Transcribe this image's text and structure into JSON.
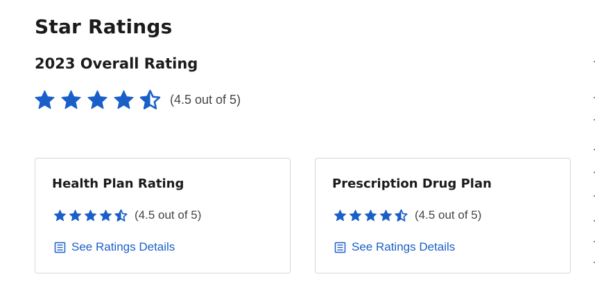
{
  "page": {
    "title": "Star Ratings"
  },
  "overall": {
    "heading": "2023 Overall Rating",
    "rating": 4.5,
    "max": 5,
    "rating_text": "(4.5 out of 5)"
  },
  "cards": [
    {
      "title": "Health Plan Rating",
      "rating": 4.5,
      "max": 5,
      "rating_text": "(4.5 out of 5)",
      "link_label": "See Ratings Details",
      "link_icon": "document-list-icon"
    },
    {
      "title": "Prescription Drug Plan",
      "rating": 4.5,
      "max": 5,
      "rating_text": "(4.5 out of 5)",
      "link_label": "See Ratings Details",
      "link_icon": "document-list-icon"
    }
  ],
  "colors": {
    "star": "#1a5fc8",
    "link": "#1a5fc8",
    "heading": "#1b1b1b",
    "muted_text": "#444444",
    "card_border": "#d6d6d6"
  },
  "icons": {
    "full_star": "star-icon",
    "half_star": "star-half-icon"
  }
}
